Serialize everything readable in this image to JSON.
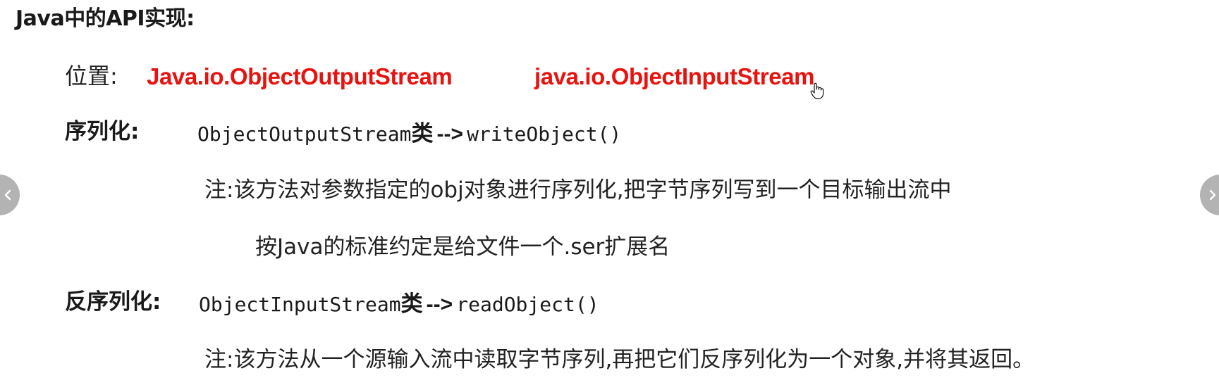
{
  "heading": "Java中的API实现:",
  "location": {
    "label": "位置:",
    "output_class": "Java.io.ObjectOutputStream",
    "input_class": "java.io.ObjectInputStream"
  },
  "serialize": {
    "label": "序列化:",
    "code_class": "ObjectOutputStream",
    "class_word": "类",
    "arrow": "-->",
    "method": "writeObject()",
    "note_line1": "注:该方法对参数指定的obj对象进行序列化,把字节序列写到一个目标输出流中",
    "note_line2": "按Java的标准约定是给文件一个.ser扩展名"
  },
  "deserialize": {
    "label": "反序列化:",
    "code_class": "ObjectInputStream",
    "class_word": "类",
    "arrow": "-->",
    "method": "readObject()",
    "note": "注:该方法从一个源输入流中读取字节序列,再把它们反序列化为一个对象,并将其返回。"
  },
  "nav": {
    "prev_icon": "chevron-left-icon",
    "next_icon": "chevron-right-icon",
    "button_color": "#b3b3b3"
  },
  "colors": {
    "accent_red": "#e8130f",
    "text": "#1a1a1a"
  }
}
